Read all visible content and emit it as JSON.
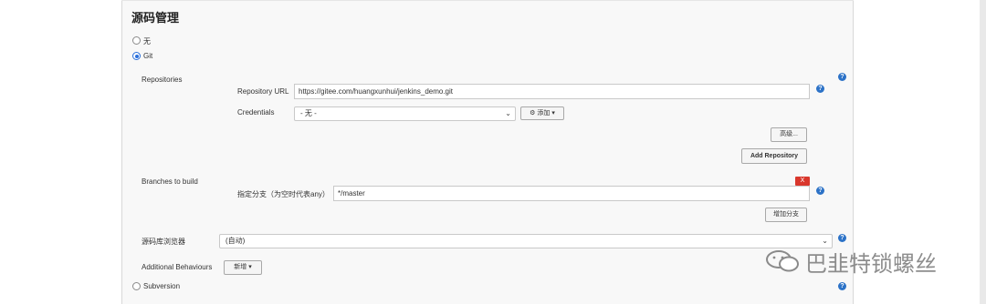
{
  "section": {
    "title": "源码管理"
  },
  "scm_options": {
    "none": "无",
    "git": "Git",
    "subversion": "Subversion"
  },
  "repositories": {
    "label": "Repositories",
    "url_label": "Repository URL",
    "url_value": "https://gitee.com/huangxunhui/jenkins_demo.git",
    "credentials_label": "Credentials",
    "credentials_value": "- 无 -",
    "add_button": "添加",
    "advanced_button": "高级...",
    "add_repository_button": "Add Repository"
  },
  "branches": {
    "label": "Branches to build",
    "delete_button": "X",
    "specifier_label": "指定分支（为空时代表any）",
    "specifier_value": "*/master",
    "add_branch_button": "增加分支"
  },
  "browser": {
    "label": "源码库浏览器",
    "value": "(自动)"
  },
  "behaviours": {
    "label": "Additional Behaviours",
    "add_button": "新增"
  },
  "watermark": {
    "text": "巴韭特锁螺丝"
  },
  "colors": {
    "help": "#2c72c7",
    "delete": "#d9372c",
    "radio_selected": "#2a6fdb"
  }
}
